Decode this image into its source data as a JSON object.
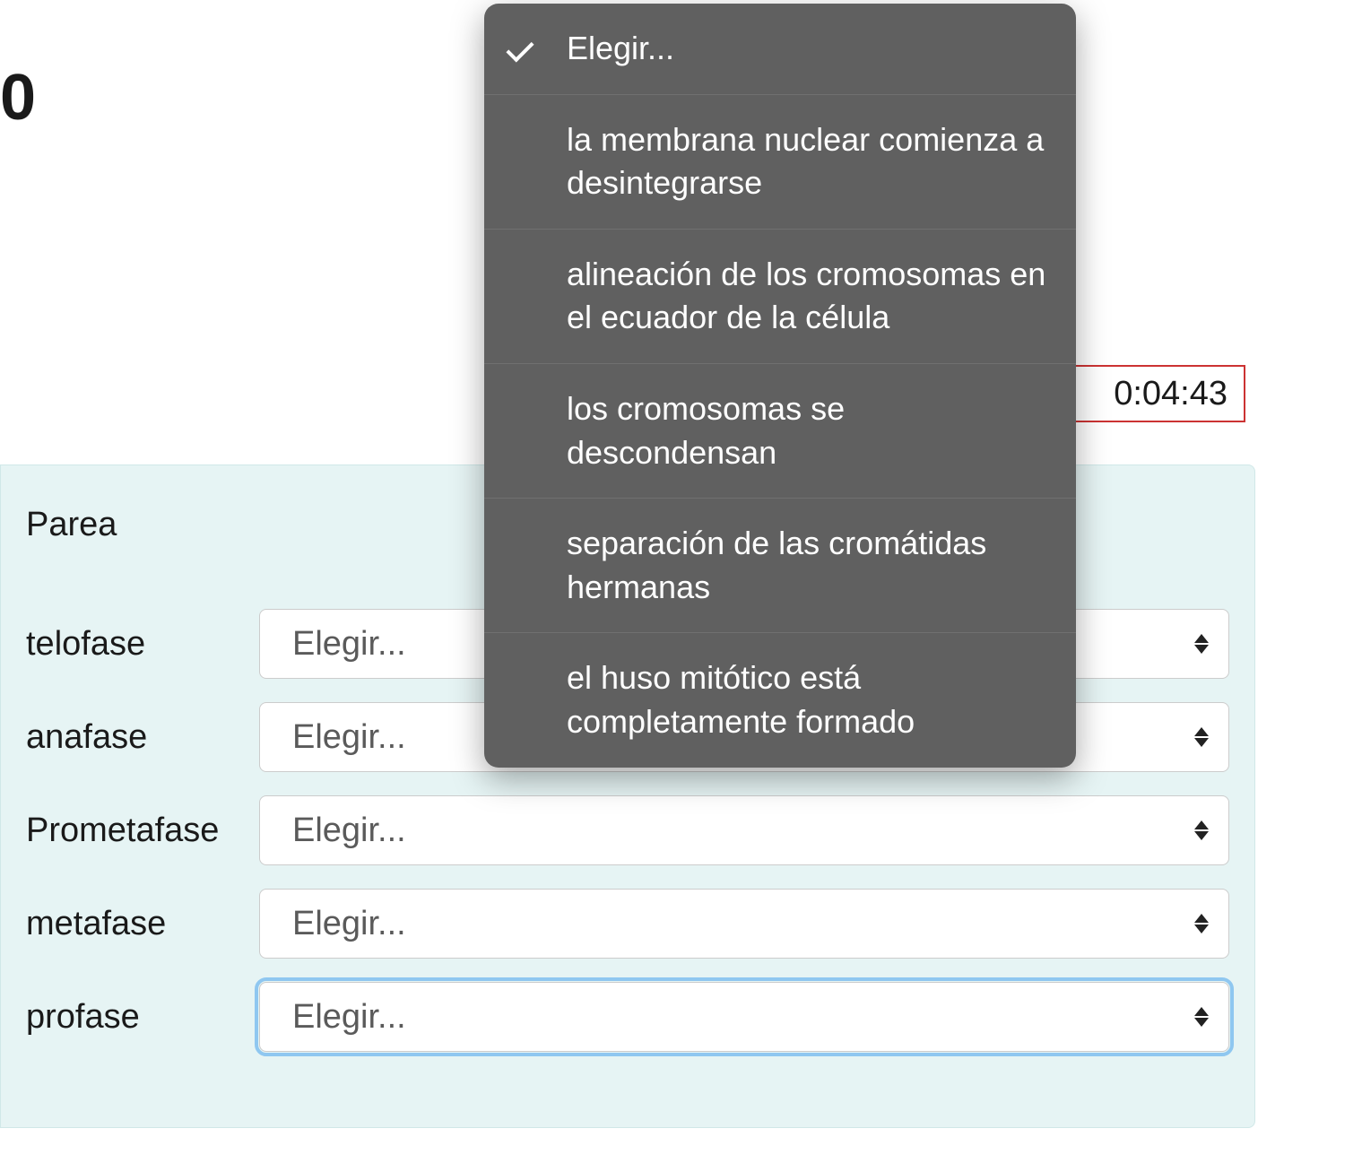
{
  "header": {
    "zero": "0"
  },
  "timer": {
    "value": "0:04:43"
  },
  "quiz": {
    "title": "Parea",
    "placeholder": "Elegir...",
    "rows": [
      {
        "label": "telofase"
      },
      {
        "label": "anafase"
      },
      {
        "label": "Prometafase"
      },
      {
        "label": "metafase"
      },
      {
        "label": "profase"
      }
    ]
  },
  "dropdown": {
    "options": [
      {
        "text": "Elegir...",
        "selected": true
      },
      {
        "text": "la membrana nuclear comienza a desintegrarse",
        "selected": false
      },
      {
        "text": "alineación de los cromosomas en el ecuador de la célula",
        "selected": false
      },
      {
        "text": "los cromosomas se descondensan",
        "selected": false
      },
      {
        "text": "separación de las cromátidas hermanas",
        "selected": false
      },
      {
        "text": "el huso mitótico está completamente formado",
        "selected": false
      }
    ]
  }
}
